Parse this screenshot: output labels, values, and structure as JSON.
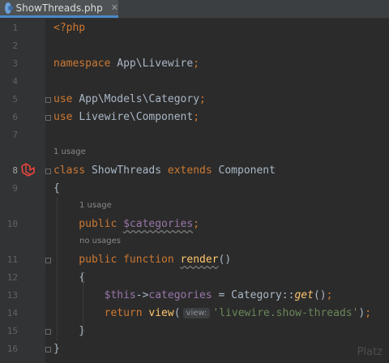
{
  "tab": {
    "filename": "ShowThreads.php",
    "close": "✕"
  },
  "lines": [
    {
      "n": "1",
      "segments": [
        {
          "t": "<?php",
          "c": "kw"
        }
      ]
    },
    {
      "n": "2",
      "segments": []
    },
    {
      "n": "3",
      "segments": [
        {
          "t": "namespace ",
          "c": "kw"
        },
        {
          "t": "App\\Livewire",
          "c": "cls"
        },
        {
          "t": ";",
          "c": "kw"
        }
      ]
    },
    {
      "n": "4",
      "segments": []
    },
    {
      "n": "5",
      "segments": [
        {
          "t": "use ",
          "c": "kw"
        },
        {
          "t": "App\\Models\\Category",
          "c": "cls"
        },
        {
          "t": ";",
          "c": "kw"
        }
      ]
    },
    {
      "n": "6",
      "segments": [
        {
          "t": "use ",
          "c": "kw"
        },
        {
          "t": "Livewire\\Component",
          "c": "cls"
        },
        {
          "t": ";",
          "c": "kw"
        }
      ]
    },
    {
      "n": "7",
      "segments": []
    },
    {
      "n": "8",
      "segments": [
        {
          "t": "class ",
          "c": "kw"
        },
        {
          "t": "ShowThreads ",
          "c": "cls"
        },
        {
          "t": "extends ",
          "c": "kw"
        },
        {
          "t": "Component",
          "c": "cls"
        }
      ]
    },
    {
      "n": "9",
      "segments": [
        {
          "t": "{",
          "c": "cls"
        }
      ]
    },
    {
      "n": "10",
      "segments": [
        {
          "t": "    public ",
          "c": "kw"
        },
        {
          "t": "$categories",
          "c": "var wavy"
        },
        {
          "t": ";",
          "c": "kw"
        }
      ]
    },
    {
      "n": "11",
      "segments": [
        {
          "t": "    public function ",
          "c": "kw"
        },
        {
          "t": "render",
          "c": "fn wavy"
        },
        {
          "t": "()",
          "c": "cls"
        }
      ]
    },
    {
      "n": "12",
      "segments": [
        {
          "t": "    {",
          "c": "cls"
        }
      ]
    },
    {
      "n": "13",
      "segments": [
        {
          "t": "        $this",
          "c": "var"
        },
        {
          "t": "->",
          "c": "cls"
        },
        {
          "t": "categories",
          "c": "var"
        },
        {
          "t": " = ",
          "c": "cls"
        },
        {
          "t": "Category",
          "c": "cls"
        },
        {
          "t": "::",
          "c": "cls"
        },
        {
          "t": "get",
          "c": "ital"
        },
        {
          "t": "()",
          "c": "cls"
        },
        {
          "t": ";",
          "c": "kw"
        }
      ]
    },
    {
      "n": "14",
      "segments": [
        {
          "t": "        return ",
          "c": "kw"
        },
        {
          "t": "view",
          "c": "fn"
        },
        {
          "t": "(",
          "c": "cls"
        },
        {
          "hint": "view:"
        },
        {
          "t": "'livewire.show-threads'",
          "c": "str"
        },
        {
          "t": ")",
          "c": "cls"
        },
        {
          "t": ";",
          "c": "kw"
        }
      ]
    },
    {
      "n": "15",
      "segments": [
        {
          "t": "    }",
          "c": "cls"
        }
      ]
    },
    {
      "n": "16",
      "segments": [
        {
          "t": "}",
          "c": "cls"
        }
      ]
    }
  ],
  "hints": {
    "class_usage": "1 usage",
    "prop_usage": "1 usage",
    "method_usage": "no usages"
  },
  "icons": {
    "laravel": "laravel-icon",
    "fold": "fold-marker-icon",
    "file": "php-file-icon"
  },
  "watermark": "Platz"
}
